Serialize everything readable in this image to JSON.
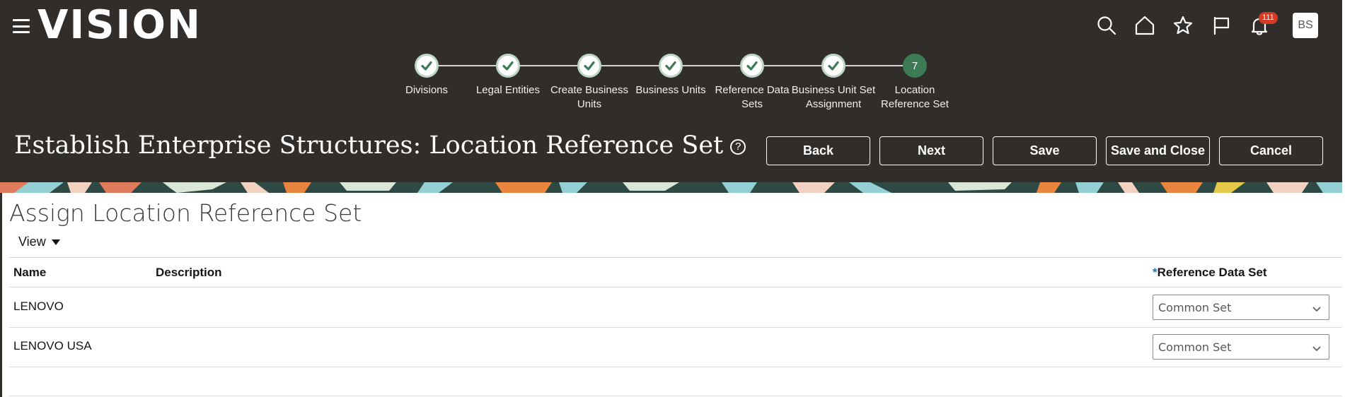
{
  "app": {
    "logo": "VISION"
  },
  "header": {
    "notifications_count": "111",
    "avatar_initials": "BS"
  },
  "train": {
    "stops": [
      {
        "label": "Divisions",
        "status": "done"
      },
      {
        "label": "Legal Entities",
        "status": "done"
      },
      {
        "label": "Create Business Units",
        "status": "done"
      },
      {
        "label": "Business Units",
        "status": "done"
      },
      {
        "label": "Reference Data Sets",
        "status": "done"
      },
      {
        "label": "Business Unit Set Assignment",
        "status": "done"
      },
      {
        "label": "Location Reference Set",
        "status": "current",
        "number": "7"
      }
    ]
  },
  "page": {
    "title": "Establish Enterprise Structures: Location Reference Set",
    "help_icon": "?"
  },
  "buttons": {
    "back": "Back",
    "next": "Next",
    "save": "Save",
    "save_and_close": "Save and Close",
    "cancel": "Cancel"
  },
  "section": {
    "title": "Assign Location Reference Set",
    "view_menu": "View"
  },
  "table": {
    "columns": {
      "name": "Name",
      "description": "Description",
      "required_marker": "*",
      "reference_data_set": "Reference Data Set"
    },
    "rows": [
      {
        "name": "LENOVO",
        "description": "",
        "reference_data_set": "Common Set"
      },
      {
        "name": "LENOVO USA",
        "description": "",
        "reference_data_set": "Common Set"
      }
    ]
  },
  "colors": {
    "header_bg": "#312d2a",
    "train_done_check": "#3c7b55",
    "train_current": "#3c7b55",
    "badge": "#d63b25",
    "required_marker": "#277aa9"
  }
}
